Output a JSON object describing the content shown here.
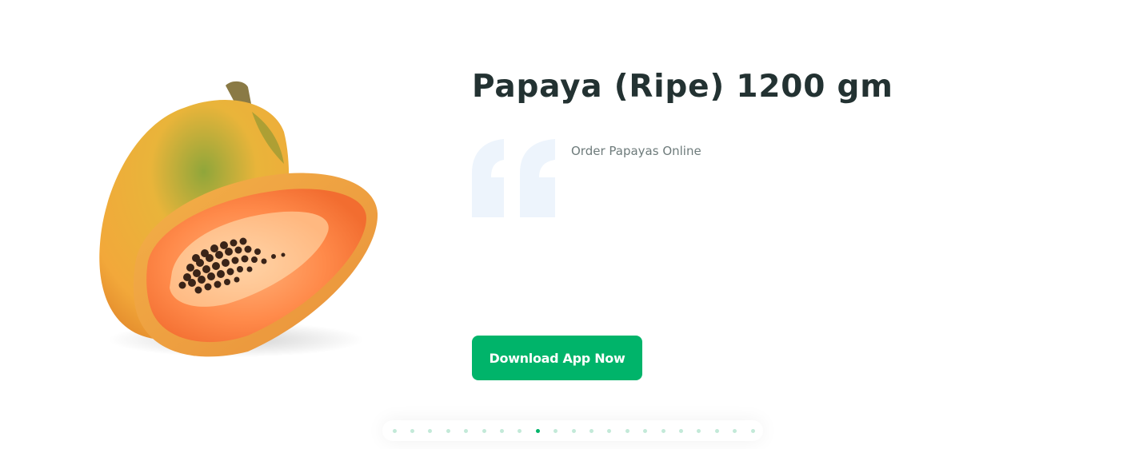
{
  "product": {
    "title": "Papaya (Ripe) 1200 gm",
    "subtitle": "Order Papayas Online",
    "image": "papaya-image"
  },
  "cta": {
    "label": "Download App Now"
  },
  "pager": {
    "total": 21,
    "active_index": 8
  },
  "colors": {
    "accent": "#00b46a",
    "title": "#233232",
    "subtitle": "#6e7b7b",
    "quote": "#edf4fc",
    "dot_inactive": "#c3e9d8"
  }
}
